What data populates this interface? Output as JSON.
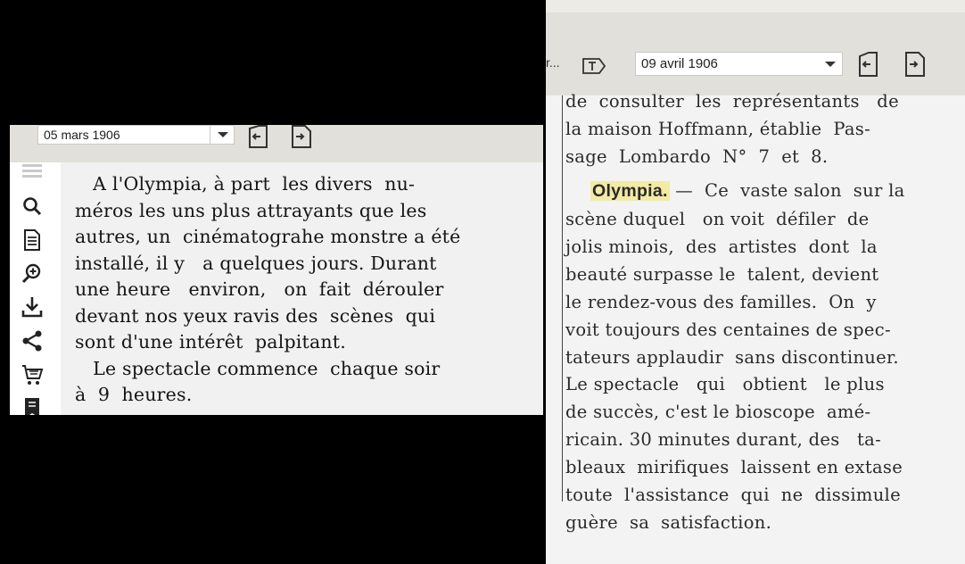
{
  "left_viewer": {
    "date": "05 mars 1906",
    "sidebar_icons": [
      "list-icon",
      "search-icon",
      "document-icon",
      "zoom-in-icon",
      "download-icon",
      "share-icon",
      "cart-icon",
      "bookmark-icon"
    ],
    "article_lines": [
      "   A l'Olympia, à part  les divers  nu-",
      "méros les uns plus attrayants que les",
      "autres, un  cinématograhe monstre a été",
      "installé, il y   a quelques jours. Durant",
      "une heure   environ,   on  fait  dérouler",
      "devant nos yeux ravis des  scènes  qui",
      "sont d'une intérêt  palpitant.",
      "   Le spectacle commence  chaque soir",
      "à  9  heures."
    ]
  },
  "right_viewer": {
    "cut_label": "r...",
    "date": "09 avril 1906",
    "article_head_lines": [
      "de  consulter  les  représentants   de",
      "la maison Hoffmann, établie  Pas-",
      "sage  Lombardo  N°  7  et  8."
    ],
    "highlight_word": "Olympia.",
    "first_line_rest": "—  Ce  vaste salon  sur la",
    "article_lines": [
      "scène duquel   on voit  défiler  de",
      "jolis minois,  des  artistes  dont  la",
      "beauté surpasse le  talent, devient",
      "le rendez-vous des familles.  On  y",
      "voit toujours des centaines de spec-",
      "tateurs applaudir  sans discontinuer.",
      "Le spectacle   qui   obtient   le plus",
      "de succès, c'est le bioscope  amé-",
      "ricain. 30 minutes durant, des   ta-",
      "bleaux  mirifiques  laissent en extase",
      "toute  l'assistance  qui  ne  dissimule",
      "guère  sa  satisfaction."
    ]
  }
}
